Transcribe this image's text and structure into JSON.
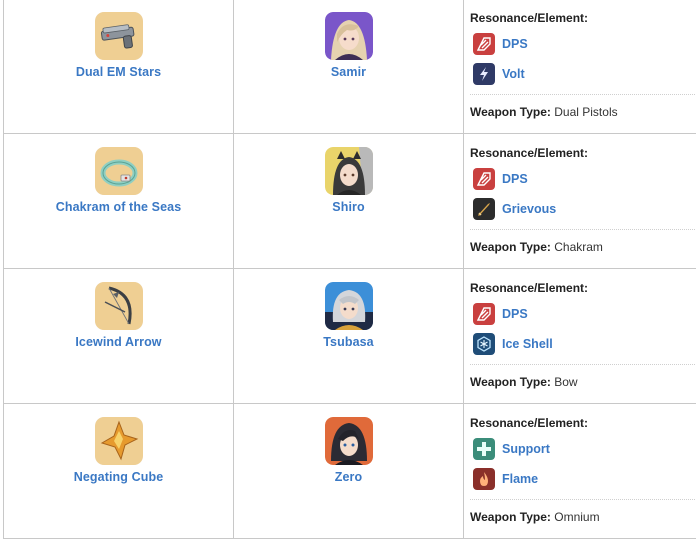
{
  "labels": {
    "resonance": "Resonance/Element:",
    "weapon_type": "Weapon Type:"
  },
  "rows": [
    {
      "weapon": {
        "name": "Dual EM Stars",
        "icon": "dual-pistols-icon"
      },
      "character": {
        "name": "Samir",
        "avatar": "samir-avatar"
      },
      "resonances": [
        {
          "label": "DPS",
          "icon": "dps-icon"
        },
        {
          "label": "Volt",
          "icon": "volt-icon"
        }
      ],
      "weapon_type": "Dual Pistols"
    },
    {
      "weapon": {
        "name": "Chakram of the Seas",
        "icon": "chakram-icon"
      },
      "character": {
        "name": "Shiro",
        "avatar": "shiro-avatar"
      },
      "resonances": [
        {
          "label": "DPS",
          "icon": "dps-icon"
        },
        {
          "label": "Grievous",
          "icon": "grievous-icon"
        }
      ],
      "weapon_type": "Chakram"
    },
    {
      "weapon": {
        "name": "Icewind Arrow",
        "icon": "bow-icon"
      },
      "character": {
        "name": "Tsubasa",
        "avatar": "tsubasa-avatar"
      },
      "resonances": [
        {
          "label": "DPS",
          "icon": "dps-icon"
        },
        {
          "label": "Ice Shell",
          "icon": "ice-shell-icon"
        }
      ],
      "weapon_type": "Bow"
    },
    {
      "weapon": {
        "name": "Negating Cube",
        "icon": "cube-icon"
      },
      "character": {
        "name": "Zero",
        "avatar": "zero-avatar"
      },
      "resonances": [
        {
          "label": "Support",
          "icon": "support-icon"
        },
        {
          "label": "Flame",
          "icon": "flame-icon"
        }
      ],
      "weapon_type": "Omnium"
    }
  ],
  "colors": {
    "link": "#3a78c4",
    "dps_badge": "#c9403f",
    "volt_badge": "#2f3a66",
    "support_badge": "#3b8d7a",
    "flame_badge": "#8a2f2a",
    "ice_badge": "#1f4d78",
    "grievous_badge": "#2c2c2c"
  }
}
